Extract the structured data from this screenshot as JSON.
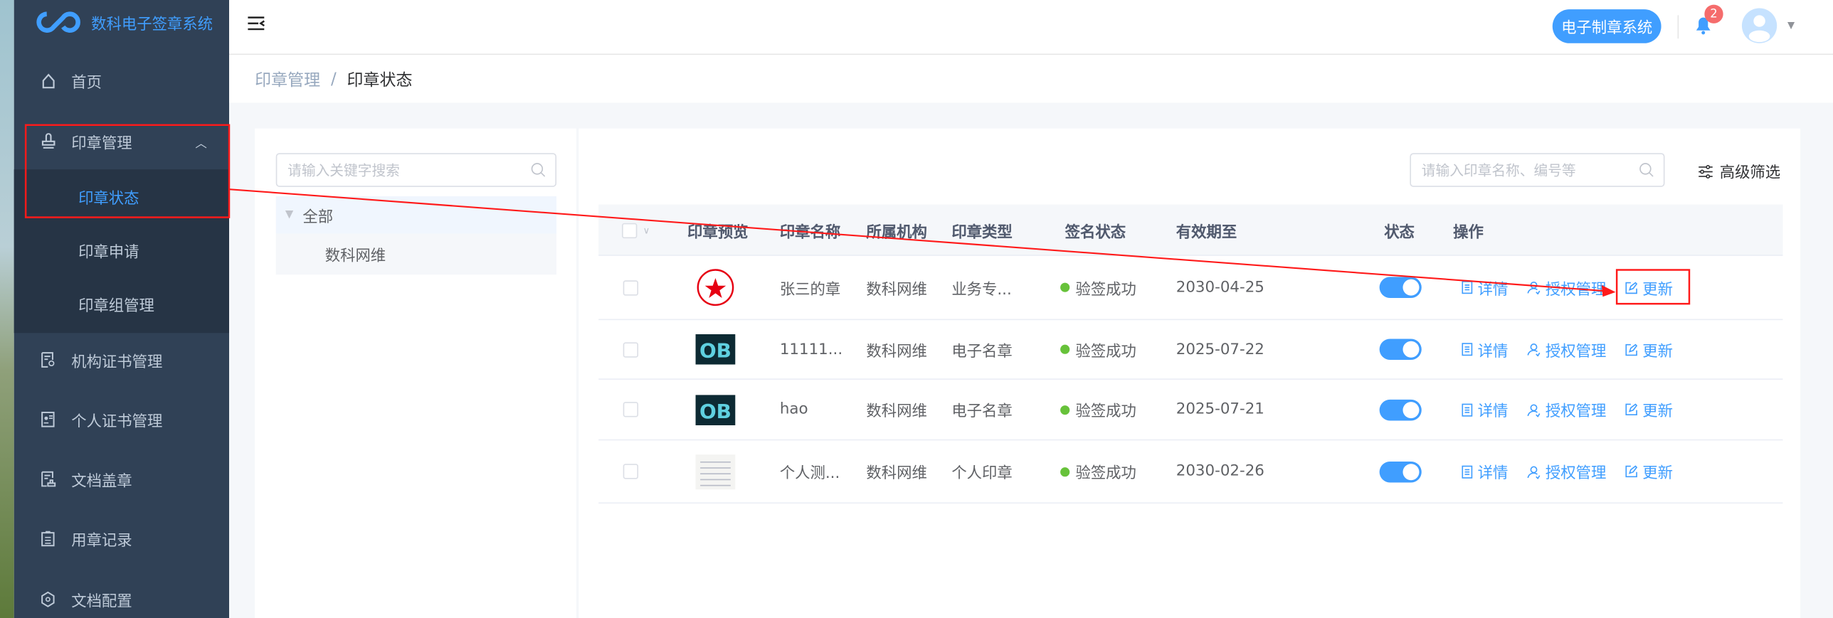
{
  "app": {
    "title": "数科电子签章系统"
  },
  "sidebar": {
    "items": [
      {
        "label": "首页",
        "icon": "home-icon"
      },
      {
        "label": "印章管理",
        "icon": "stamp-icon",
        "expanded": true,
        "children": [
          {
            "label": "印章状态",
            "active": true
          },
          {
            "label": "印章申请"
          },
          {
            "label": "印章组管理"
          }
        ]
      },
      {
        "label": "机构证书管理",
        "icon": "org-certificate-icon"
      },
      {
        "label": "个人证书管理",
        "icon": "personal-certificate-icon"
      },
      {
        "label": "文档盖章",
        "icon": "document-stamp-icon"
      },
      {
        "label": "用章记录",
        "icon": "clipboard-icon"
      },
      {
        "label": "文档配置",
        "icon": "settings-hex-icon"
      }
    ]
  },
  "header": {
    "system_button": "电子制章系统",
    "notification_count": "2"
  },
  "breadcrumb": {
    "parent": "印章管理",
    "separator": "/",
    "current": "印章状态"
  },
  "tree": {
    "search_placeholder": "请输入关键字搜索",
    "root": "全部",
    "children": [
      "数科网维"
    ]
  },
  "toolbar": {
    "search_placeholder": "请输入印章名称、编号等",
    "advanced_filter": "高级筛选"
  },
  "table": {
    "columns": [
      "印章预览",
      "印章名称",
      "所属机构",
      "印章类型",
      "签名状态",
      "有效期至",
      "状态",
      "操作"
    ],
    "rows": [
      {
        "preview": "red-round-seal",
        "name": "张三的章",
        "org": "数科网维",
        "type": "业务专...",
        "sign_status": "验签成功",
        "expiry": "2030-04-25",
        "enabled": true
      },
      {
        "preview": "ob-logo",
        "name": "11111...",
        "org": "数科网维",
        "type": "电子名章",
        "sign_status": "验签成功",
        "expiry": "2025-07-22",
        "enabled": true
      },
      {
        "preview": "ob-logo",
        "name": "hao",
        "org": "数科网维",
        "type": "电子名章",
        "sign_status": "验签成功",
        "expiry": "2025-07-21",
        "enabled": true
      },
      {
        "preview": "calendar-image",
        "name": "个人测...",
        "org": "数科网维",
        "type": "个人印章",
        "sign_status": "验签成功",
        "expiry": "2030-02-26",
        "enabled": true
      }
    ],
    "actions": {
      "detail": "详情",
      "auth": "授权管理",
      "update": "更新"
    }
  },
  "colors": {
    "sidebar": "#304156",
    "accent": "#409eff",
    "success": "#67c23a",
    "annotation": "#ff1a1a"
  }
}
